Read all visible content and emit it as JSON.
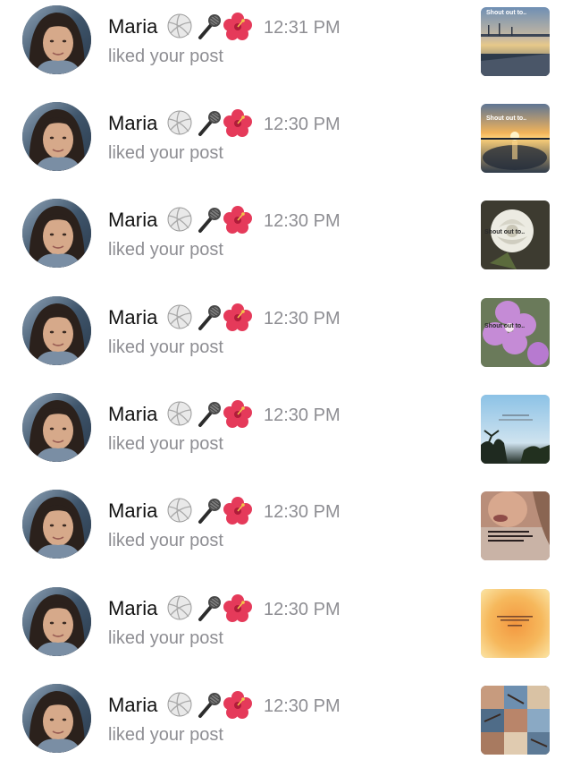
{
  "notifications": [
    {
      "name": "Maria",
      "emojis": [
        "volleyball-icon",
        "microphone-icon",
        "hibiscus-icon"
      ],
      "time": "12:31 PM",
      "action": "liked your post",
      "post": {
        "caption": "Shout out to..",
        "theme": "harbor-sunset"
      }
    },
    {
      "name": "Maria",
      "emojis": [
        "volleyball-icon",
        "microphone-icon",
        "hibiscus-icon"
      ],
      "time": "12:30 PM",
      "action": "liked your post",
      "post": {
        "caption": "Shout out to..",
        "theme": "sunset-reflection"
      }
    },
    {
      "name": "Maria",
      "emojis": [
        "volleyball-icon",
        "microphone-icon",
        "hibiscus-icon"
      ],
      "time": "12:30 PM",
      "action": "liked your post",
      "post": {
        "caption": "Shout out to..",
        "theme": "white-rose"
      }
    },
    {
      "name": "Maria",
      "emojis": [
        "volleyball-icon",
        "microphone-icon",
        "hibiscus-icon"
      ],
      "time": "12:30 PM",
      "action": "liked your post",
      "post": {
        "caption": "Shout out to..",
        "theme": "purple-flower"
      }
    },
    {
      "name": "Maria",
      "emojis": [
        "volleyball-icon",
        "microphone-icon",
        "hibiscus-icon"
      ],
      "time": "12:30 PM",
      "action": "liked your post",
      "post": {
        "caption": "",
        "theme": "palm-sky"
      }
    },
    {
      "name": "Maria",
      "emojis": [
        "volleyball-icon",
        "microphone-icon",
        "hibiscus-icon"
      ],
      "time": "12:30 PM",
      "action": "liked your post",
      "post": {
        "caption": "",
        "theme": "selfie-text"
      }
    },
    {
      "name": "Maria",
      "emojis": [
        "volleyball-icon",
        "microphone-icon",
        "hibiscus-icon"
      ],
      "time": "12:30 PM",
      "action": "liked your post",
      "post": {
        "caption": "",
        "theme": "orange-gradient"
      }
    },
    {
      "name": "Maria",
      "emojis": [
        "volleyball-icon",
        "microphone-icon",
        "hibiscus-icon"
      ],
      "time": "12:30 PM",
      "action": "liked your post",
      "post": {
        "caption": "",
        "theme": "collage"
      }
    }
  ],
  "colors": {
    "name_text": "#111111",
    "secondary_text": "#8e8e93",
    "background": "#ffffff"
  }
}
